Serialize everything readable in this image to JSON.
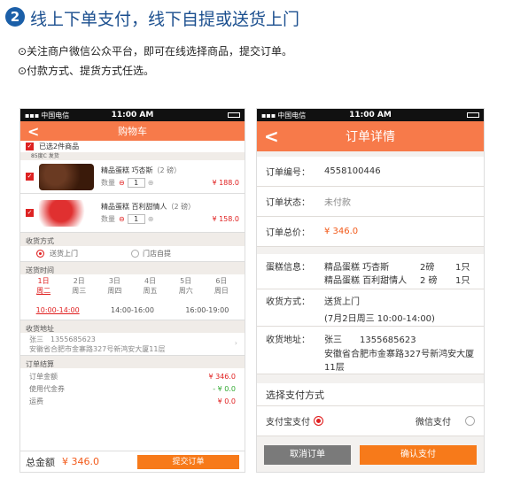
{
  "header": {
    "step": "2",
    "title": "线上下单支付，线下自提或送货上门"
  },
  "bullets": [
    "⊙关注商户微信公众平台，即可在线选择商品，提交订单。",
    "⊙付款方式、提货方式任选。"
  ],
  "status": {
    "carrier": "中国电信",
    "time": "11:00 AM"
  },
  "cart": {
    "title": "购物车",
    "selected": "已选2件商品",
    "shop": "85度C 发货",
    "items": [
      {
        "name": "精品蛋糕 巧杏斯",
        "size": "（2 磅）",
        "qty_label": "数量",
        "qty": "1",
        "price": "¥ 188.0"
      },
      {
        "name": "精品蛋糕 百利甜情人",
        "size": "（2 磅）",
        "qty_label": "数量",
        "qty": "1",
        "price": "¥ 158.0"
      }
    ],
    "delivery": {
      "title": "收货方式",
      "opt1": "送货上门",
      "opt2": "门店自提"
    },
    "time": {
      "title": "送货时间",
      "days": [
        {
          "d": "1日",
          "w": "周二"
        },
        {
          "d": "2日",
          "w": "周三"
        },
        {
          "d": "3日",
          "w": "周四"
        },
        {
          "d": "4日",
          "w": "周五"
        },
        {
          "d": "5日",
          "w": "周六"
        },
        {
          "d": "6日",
          "w": "周日"
        }
      ],
      "slots": [
        "10:00-14:00",
        "14:00-16:00",
        "16:00-19:00"
      ]
    },
    "address": {
      "title": "收货地址",
      "name": "张三　1355685623",
      "detail": "安徽省合肥市金寨路327号新鸿安大厦11层"
    },
    "summary": {
      "title": "订单结算",
      "rows": [
        {
          "l": "订单金额",
          "v": "¥ 346.0"
        },
        {
          "l": "使用代金券",
          "v": "- ¥ 0.0"
        },
        {
          "l": "运费",
          "v": "¥ 0.0"
        }
      ]
    },
    "footer": {
      "total_label": "总金额",
      "total": "¥ 346.0",
      "submit": "提交订单"
    }
  },
  "order": {
    "title": "订单详情",
    "no_l": "订单编号：",
    "no_v": "4558100446",
    "st_l": "订单状态：",
    "st_v": "未付款",
    "tot_l": "订单总价：",
    "tot_v": "¥ 346.0",
    "info_l": "蛋糕信息：",
    "items": [
      {
        "n": "精品蛋糕 巧杏斯",
        "s": "2磅",
        "q": "1只"
      },
      {
        "n": "精品蛋糕 百利甜情人",
        "s": "2 磅",
        "q": "1只"
      }
    ],
    "way_l": "收货方式：",
    "way1": "送货上门",
    "way2": "(7月2日周三  10:00-14:00)",
    "addr_l": "收货地址：",
    "addr_name": "张三　　1355685623",
    "addr_detail": "安徽省合肥市金寨路327号新鸿安大厦11层",
    "pay_title": "选择支付方式",
    "pay1": "支付宝支付",
    "pay2": "微信支付",
    "cancel": "取消订单",
    "confirm": "确认支付"
  },
  "colors": {
    "accent": "#f77a4a",
    "heading": "#1b4f8f",
    "price": "#e02020"
  }
}
